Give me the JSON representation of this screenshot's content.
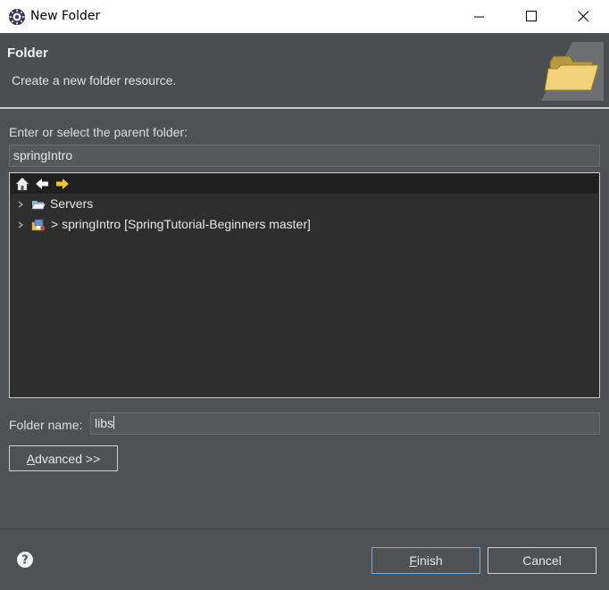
{
  "window": {
    "title": "New Folder"
  },
  "banner": {
    "title": "Folder",
    "description": "Create a new folder resource."
  },
  "parent_folder": {
    "label": "Enter or select the parent folder:",
    "value": "springIntro"
  },
  "tree": {
    "toolbar_icons": [
      "home-icon",
      "back-arrow-icon",
      "forward-arrow-icon"
    ],
    "items": [
      {
        "label": "Servers",
        "icon": "open-folder-icon",
        "expanded": false
      },
      {
        "label": "> springIntro [SpringTutorial-Beginners master]",
        "icon": "project-icon",
        "expanded": false
      }
    ]
  },
  "folder_name": {
    "label": "Folder name:",
    "value": "libs"
  },
  "buttons": {
    "advanced_mnemonic": "A",
    "advanced_rest": "dvanced >>",
    "finish_mnemonic": "F",
    "finish_rest": "inish",
    "cancel": "Cancel"
  },
  "colors": {
    "background": "#4e5254",
    "tree_background": "#2e2e2e",
    "accent_border": "#7aa9d8"
  }
}
